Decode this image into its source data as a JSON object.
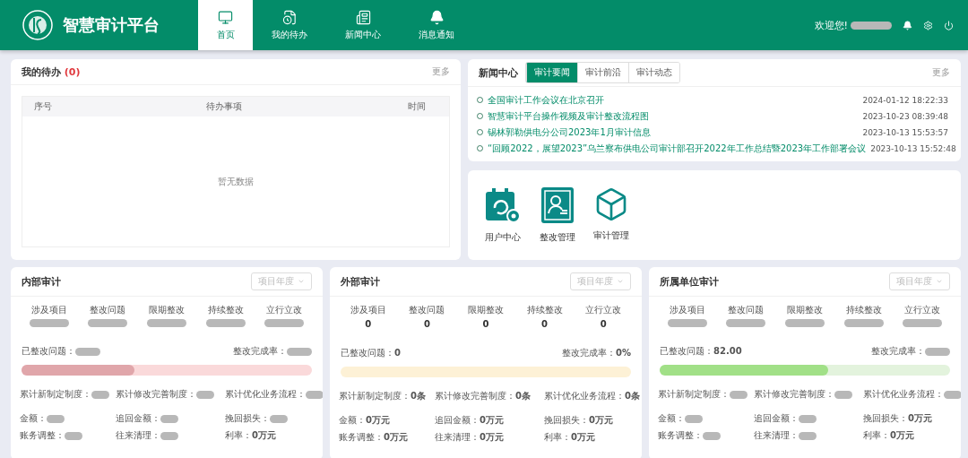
{
  "header": {
    "title": "智慧审计平台",
    "nav": [
      {
        "label": "首页",
        "selected": true
      },
      {
        "label": "我的待办",
        "selected": false
      },
      {
        "label": "新闻中心",
        "selected": false
      },
      {
        "label": "消息通知",
        "selected": false
      }
    ],
    "greeting": "欢迎您!"
  },
  "todo": {
    "title": "我的待办",
    "count": "(0)",
    "more": "更多",
    "columns": [
      "序号",
      "待办事项",
      "时间"
    ],
    "empty": "暂无数据"
  },
  "news": {
    "title": "新闻中心",
    "more": "更多",
    "tabs": [
      {
        "label": "审计要闻",
        "selected": true
      },
      {
        "label": "审计前沿",
        "selected": false
      },
      {
        "label": "审计动态",
        "selected": false
      }
    ],
    "items": [
      {
        "title": "全国审计工作会议在北京召开",
        "time": "2024-01-12 18:22:33"
      },
      {
        "title": "智慧审计平台操作视频及审计整改流程图",
        "time": "2023-10-23 08:39:48"
      },
      {
        "title": "锡林郭勒供电分公司2023年1月审计信息",
        "time": "2023-10-13 15:53:57"
      },
      {
        "title": "“回顾2022，展望2023”乌兰察布供电公司审计部召开2022年工作总结暨2023年工作部署会议",
        "time": "2023-10-13 15:52:48"
      }
    ]
  },
  "shortcuts": [
    {
      "label": "用户中心"
    },
    {
      "label": "整改管理"
    },
    {
      "label": "审计管理"
    }
  ],
  "cards": [
    {
      "title": "内部审计",
      "select": "项目年度",
      "color": "#fad9da",
      "stats": [
        {
          "label": "涉及项目"
        },
        {
          "label": "整改问题"
        },
        {
          "label": "限期整改"
        },
        {
          "label": "持续整改"
        },
        {
          "label": "立行立改"
        }
      ],
      "fixed_label": "已整改问题：",
      "rate_label": "整改完成率：",
      "level": 0.39,
      "fields": [
        [
          {
            "label": "累计新制定制度："
          },
          {
            "label": "累计修改完善制度："
          },
          {
            "label": "累计优化业务流程："
          }
        ],
        [
          {
            "label": "金额："
          },
          {
            "label": "追回金额："
          },
          {
            "label": "挽回损失："
          }
        ],
        [
          {
            "label": "账务调整："
          },
          {
            "label": "往来清理："
          },
          {
            "label": "利率：",
            "value": "0万元"
          }
        ]
      ]
    },
    {
      "title": "外部审计",
      "select": "项目年度",
      "color": "#fdf1d6",
      "stats": [
        {
          "label": "涉及项目",
          "value": "0"
        },
        {
          "label": "整改问题",
          "value": "0"
        },
        {
          "label": "限期整改",
          "value": "0"
        },
        {
          "label": "持续整改",
          "value": "0"
        },
        {
          "label": "立行立改",
          "value": "0"
        }
      ],
      "fixed_label": "已整改问题：",
      "fixed_value": "0",
      "rate_label": "整改完成率：",
      "rate_value": "0%",
      "level": 0,
      "fields": [
        [
          {
            "label": "累计新制定制度：",
            "value": "0条"
          },
          {
            "label": "累计修改完善制度：",
            "value": "0条"
          },
          {
            "label": "累计优化业务流程：",
            "value": "0条"
          }
        ],
        [
          {
            "label": "金额：",
            "value": "0万元"
          },
          {
            "label": "追回金额：",
            "value": "0万元"
          },
          {
            "label": "挽回损失：",
            "value": "0万元"
          }
        ],
        [
          {
            "label": "账务调整：",
            "value": "0万元"
          },
          {
            "label": "往来清理：",
            "value": "0万元"
          },
          {
            "label": "利率：",
            "value": "0万元"
          }
        ]
      ]
    },
    {
      "title": "所属单位审计",
      "select": "项目年度",
      "color": "#e3f3dd",
      "stats": [
        {
          "label": "涉及项目"
        },
        {
          "label": "整改问题"
        },
        {
          "label": "限期整改"
        },
        {
          "label": "持续整改"
        },
        {
          "label": "立行立改"
        }
      ],
      "fixed_label": "已整改问题：",
      "fixed_value": "82.00",
      "rate_label": "整改完成率：",
      "level": 0.58,
      "fields": [
        [
          {
            "label": "累计新制定制度："
          },
          {
            "label": "累计修改完善制度："
          },
          {
            "label": "累计优化业务流程："
          }
        ],
        [
          {
            "label": "金额："
          },
          {
            "label": "追回金额："
          },
          {
            "label": "挽回损失：",
            "value": "0万元"
          }
        ],
        [
          {
            "label": "账务调整："
          },
          {
            "label": "往来清理："
          },
          {
            "label": "利率：",
            "value": "0万元"
          }
        ]
      ]
    }
  ]
}
